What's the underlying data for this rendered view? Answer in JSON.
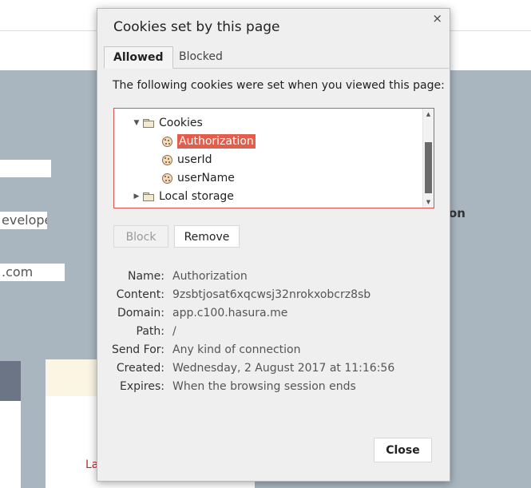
{
  "background": {
    "fields": [
      "",
      "eveloper",
      ".com"
    ],
    "side_text": "on",
    "card_text": "La"
  },
  "dialog": {
    "title": "Cookies set by this page",
    "close_x": "×",
    "tabs": [
      {
        "label": "Allowed",
        "active": true
      },
      {
        "label": "Blocked",
        "active": false
      }
    ],
    "description": "The following cookies were set when you viewed this page:",
    "tree": {
      "items": [
        {
          "label": "Cookies",
          "type": "folder",
          "expanded": true,
          "level": 1
        },
        {
          "label": "Authorization",
          "type": "cookie",
          "selected": true,
          "level": 2
        },
        {
          "label": "userId",
          "type": "cookie",
          "selected": false,
          "level": 2
        },
        {
          "label": "userName",
          "type": "cookie",
          "selected": false,
          "level": 2
        },
        {
          "label": "Local storage",
          "type": "folder",
          "expanded": false,
          "level": 1
        }
      ]
    },
    "buttons": {
      "block": "Block",
      "remove": "Remove",
      "close": "Close"
    },
    "details": [
      {
        "label": "Name:",
        "value": "Authorization"
      },
      {
        "label": "Content:",
        "value": "9zsbtjosat6xqcwsj32nrokxobcrz8sb"
      },
      {
        "label": "Domain:",
        "value": "app.c100.hasura.me"
      },
      {
        "label": "Path:",
        "value": "/"
      },
      {
        "label": "Send For:",
        "value": "Any kind of connection"
      },
      {
        "label": "Created:",
        "value": "Wednesday, 2 August 2017 at 11:16:56"
      },
      {
        "label": "Expires:",
        "value": "When the browsing session ends"
      }
    ],
    "colors": {
      "selection": "#e25d4c",
      "tree_border": "#d9534f",
      "dialog_bg": "#efefef"
    }
  }
}
